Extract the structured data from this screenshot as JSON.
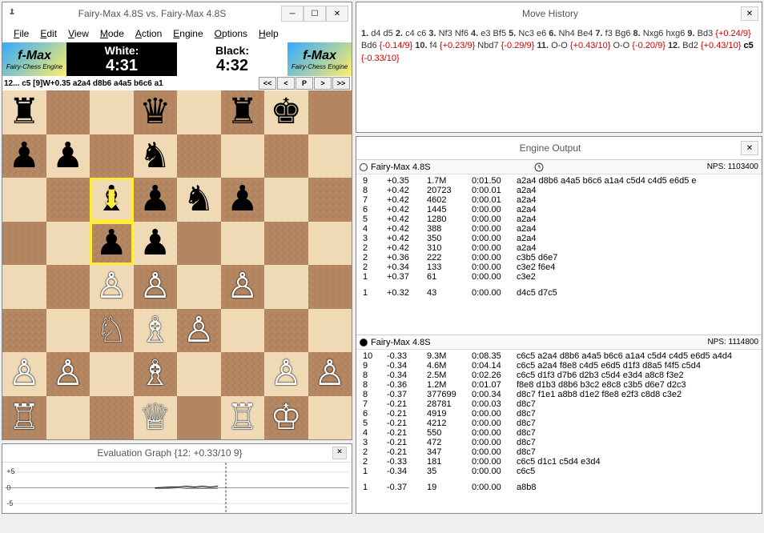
{
  "main": {
    "title": "Fairy-Max 4.8S vs. Fairy-Max 4.8S",
    "menu": [
      "File",
      "Edit",
      "View",
      "Mode",
      "Action",
      "Engine",
      "Options",
      "Help"
    ],
    "logo_big": "f-Max",
    "logo_small": "Fairy-Chess Engine",
    "white_label": "White:",
    "white_time": "4:31",
    "black_label": "Black:",
    "black_time": "4:32",
    "info_text": "12... c5   [9]W+0.35 a2a4 d8b6 a4a5 b6c6 a1",
    "nav_btns": [
      "<<",
      "<",
      "P",
      ">",
      ">>"
    ]
  },
  "board": {
    "rows": [
      [
        "r",
        ".",
        ".",
        "q",
        ".",
        "r",
        "k",
        "."
      ],
      [
        "p",
        "p",
        ".",
        "n",
        ".",
        ".",
        ".",
        "."
      ],
      [
        ".",
        ".",
        "b",
        "p",
        "n",
        "p",
        ".",
        "."
      ],
      [
        ".",
        ".",
        "p",
        "p",
        ".",
        ".",
        ".",
        "."
      ],
      [
        ".",
        ".",
        "P",
        "P",
        ".",
        "P",
        ".",
        "."
      ],
      [
        ".",
        ".",
        "N",
        "B",
        "P",
        ".",
        ".",
        "."
      ],
      [
        "P",
        "P",
        ".",
        "B",
        ".",
        ".",
        "P",
        "P"
      ],
      [
        "R",
        ".",
        ".",
        "Q",
        ".",
        "R",
        "K",
        "."
      ]
    ],
    "highlights": [
      "c6",
      "c5"
    ]
  },
  "eval": {
    "title": "Evaluation Graph {12: +0.33/10 9}",
    "y_labels": [
      "+5",
      "0",
      "-5"
    ]
  },
  "history": {
    "title": "Move History",
    "moves": [
      {
        "n": "1.",
        "w": "d4",
        "wc": "",
        "b": "d5",
        "bc": ""
      },
      {
        "n": "2.",
        "w": "c4",
        "wc": "",
        "b": "c6",
        "bc": ""
      },
      {
        "n": "3.",
        "w": "Nf3",
        "wc": "",
        "b": "Nf6",
        "bc": ""
      },
      {
        "n": "4.",
        "w": "e3",
        "wc": "",
        "b": "Bf5",
        "bc": ""
      },
      {
        "n": "5.",
        "w": "Nc3",
        "wc": "",
        "b": "e6",
        "bc": ""
      },
      {
        "n": "6.",
        "w": "Nh4",
        "wc": "",
        "b": "Be4",
        "bc": ""
      },
      {
        "n": "7.",
        "w": "f3",
        "wc": "",
        "b": "Bg6",
        "bc": ""
      },
      {
        "n": "8.",
        "w": "Nxg6",
        "wc": "",
        "b": "hxg6",
        "bc": ""
      },
      {
        "n": "9.",
        "w": "Bd3",
        "wc": "{+0.24/9}",
        "b": "Bd6",
        "bc": "{-0.14/9}"
      },
      {
        "n": "10.",
        "w": "f4",
        "wc": "{+0.23/9}",
        "b": "Nbd7",
        "bc": "{-0.29/9}"
      },
      {
        "n": "11.",
        "w": "O-O",
        "wc": "{+0.43/10}",
        "b": "O-O",
        "bc": "{-0.20/9}"
      },
      {
        "n": "12.",
        "w": "Bd2",
        "wc": "{+0.43/10}",
        "b": "c5",
        "bc": "{-0.33/10}",
        "last": true
      }
    ]
  },
  "engine": {
    "title": "Engine Output",
    "pane1": {
      "name": "Fairy-Max 4.8S",
      "nps": "NPS: 1103400",
      "rows": [
        {
          "d": "9",
          "s": "+0.35",
          "n": "1.7M",
          "t": "0:01.50",
          "pv": "a2a4 d8b6 a4a5 b6c6 a1a4 c5d4 c4d5 e6d5 e"
        },
        {
          "d": "8",
          "s": "+0.42",
          "n": "20723",
          "t": "0:00.01",
          "pv": "a2a4"
        },
        {
          "d": "7",
          "s": "+0.42",
          "n": "4602",
          "t": "0:00.01",
          "pv": "a2a4"
        },
        {
          "d": "6",
          "s": "+0.42",
          "n": "1445",
          "t": "0:00.00",
          "pv": "a2a4"
        },
        {
          "d": "5",
          "s": "+0.42",
          "n": "1280",
          "t": "0:00.00",
          "pv": "a2a4"
        },
        {
          "d": "4",
          "s": "+0.42",
          "n": "388",
          "t": "0:00.00",
          "pv": "a2a4"
        },
        {
          "d": "3",
          "s": "+0.42",
          "n": "350",
          "t": "0:00.00",
          "pv": "a2a4"
        },
        {
          "d": "2",
          "s": "+0.42",
          "n": "310",
          "t": "0:00.00",
          "pv": "a2a4"
        },
        {
          "d": "2",
          "s": "+0.36",
          "n": "222",
          "t": "0:00.00",
          "pv": "c3b5 d6e7"
        },
        {
          "d": "2",
          "s": "+0.34",
          "n": "133",
          "t": "0:00.00",
          "pv": "c3e2 f6e4"
        },
        {
          "d": "1",
          "s": "+0.37",
          "n": "61",
          "t": "0:00.00",
          "pv": "c3e2"
        }
      ],
      "extra": {
        "d": "1",
        "s": "+0.32",
        "n": "43",
        "t": "0:00.00",
        "pv": "d4c5 d7c5"
      }
    },
    "pane2": {
      "name": "Fairy-Max 4.8S",
      "nps": "NPS: 1114800",
      "rows": [
        {
          "d": "10",
          "s": "-0.33",
          "n": "9.3M",
          "t": "0:08.35",
          "pv": "c6c5 a2a4 d8b6 a4a5 b6c6 a1a4 c5d4 c4d5 e6d5 a4d4"
        },
        {
          "d": "9",
          "s": "-0.34",
          "n": "4.6M",
          "t": "0:04.14",
          "pv": "c6c5 a2a4 f8e8 c4d5 e6d5 d1f3 d8a5 f4f5 c5d4"
        },
        {
          "d": "8",
          "s": "-0.34",
          "n": "2.5M",
          "t": "0:02.26",
          "pv": "c6c5 d1f3 d7b6 d2b3 c5d4 e3d4 a8c8 f3e2"
        },
        {
          "d": "8",
          "s": "-0.36",
          "n": "1.2M",
          "t": "0:01.07",
          "pv": "f8e8 d1b3 d8b6 b3c2 e8c8 c3b5 d6e7 d2c3"
        },
        {
          "d": "8",
          "s": "-0.37",
          "n": "377699",
          "t": "0:00.34",
          "pv": "d8c7 f1e1 a8b8 d1e2 f8e8 e2f3 c8d8 c3e2"
        },
        {
          "d": "7",
          "s": "-0.21",
          "n": "28781",
          "t": "0:00.03",
          "pv": "d8c7"
        },
        {
          "d": "6",
          "s": "-0.21",
          "n": "4919",
          "t": "0:00.00",
          "pv": "d8c7"
        },
        {
          "d": "5",
          "s": "-0.21",
          "n": "4212",
          "t": "0:00.00",
          "pv": "d8c7"
        },
        {
          "d": "4",
          "s": "-0.21",
          "n": "550",
          "t": "0:00.00",
          "pv": "d8c7"
        },
        {
          "d": "3",
          "s": "-0.21",
          "n": "472",
          "t": "0:00.00",
          "pv": "d8c7"
        },
        {
          "d": "2",
          "s": "-0.21",
          "n": "347",
          "t": "0:00.00",
          "pv": "d8c7"
        },
        {
          "d": "2",
          "s": "-0.33",
          "n": "181",
          "t": "0:00.00",
          "pv": "c6c5 d1c1 c5d4 e3d4"
        },
        {
          "d": "1",
          "s": "-0.34",
          "n": "35",
          "t": "0:00.00",
          "pv": "c6c5"
        }
      ],
      "extra": {
        "d": "1",
        "s": "-0.37",
        "n": "19",
        "t": "0:00.00",
        "pv": "a8b8"
      }
    }
  }
}
